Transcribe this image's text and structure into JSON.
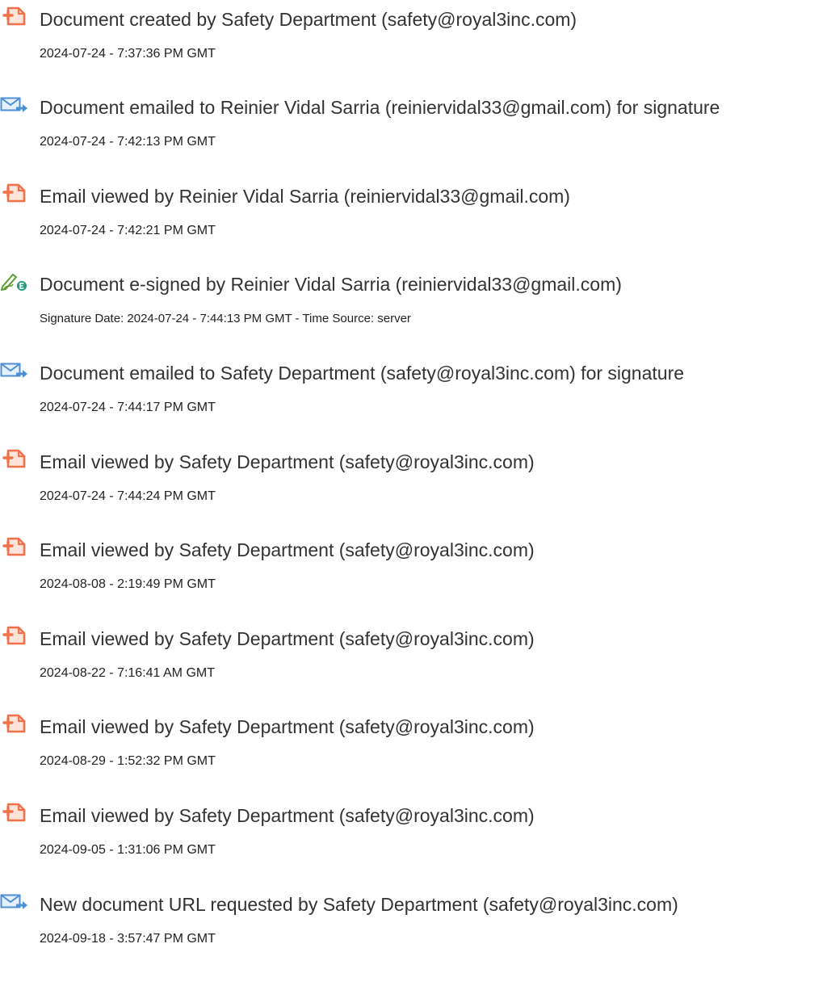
{
  "events": [
    {
      "icon": "document-created-icon",
      "title": "Document created by Safety Department (safety@royal3inc.com)",
      "detail": "2024-07-24 - 7:37:36 PM GMT"
    },
    {
      "icon": "email-sent-icon",
      "title": "Document emailed to Reinier Vidal Sarria (reiniervidal33@gmail.com) for signature",
      "detail": "2024-07-24 - 7:42:13 PM GMT"
    },
    {
      "icon": "document-viewed-icon",
      "title": "Email viewed by Reinier Vidal Sarria (reiniervidal33@gmail.com)",
      "detail": "2024-07-24 - 7:42:21 PM GMT"
    },
    {
      "icon": "e-signature-icon",
      "title": "Document e-signed by Reinier Vidal Sarria (reiniervidal33@gmail.com)",
      "detail": "Signature Date: 2024-07-24 - 7:44:13 PM GMT - Time Source: server"
    },
    {
      "icon": "email-sent-icon",
      "title": "Document emailed to Safety Department (safety@royal3inc.com) for signature",
      "detail": "2024-07-24 - 7:44:17 PM GMT"
    },
    {
      "icon": "document-viewed-icon",
      "title": "Email viewed by Safety Department (safety@royal3inc.com)",
      "detail": "2024-07-24 - 7:44:24 PM GMT"
    },
    {
      "icon": "document-viewed-icon",
      "title": "Email viewed by Safety Department (safety@royal3inc.com)",
      "detail": "2024-08-08 - 2:19:49 PM GMT"
    },
    {
      "icon": "document-viewed-icon",
      "title": "Email viewed by Safety Department (safety@royal3inc.com)",
      "detail": "2024-08-22 - 7:16:41 AM GMT"
    },
    {
      "icon": "document-viewed-icon",
      "title": "Email viewed by Safety Department (safety@royal3inc.com)",
      "detail": "2024-08-29 - 1:52:32 PM GMT"
    },
    {
      "icon": "document-viewed-icon",
      "title": "Email viewed by Safety Department (safety@royal3inc.com)",
      "detail": "2024-09-05 - 1:31:06 PM GMT"
    },
    {
      "icon": "email-sent-icon",
      "title": "New document URL requested by Safety Department (safety@royal3inc.com)",
      "detail": "2024-09-18 - 3:57:47 PM GMT"
    }
  ],
  "colors": {
    "document_icon": "#f2714a",
    "email_icon": "#4d8fd6",
    "signature_icon": "#5a9e2f",
    "signature_badge": "#2a9a7a"
  }
}
